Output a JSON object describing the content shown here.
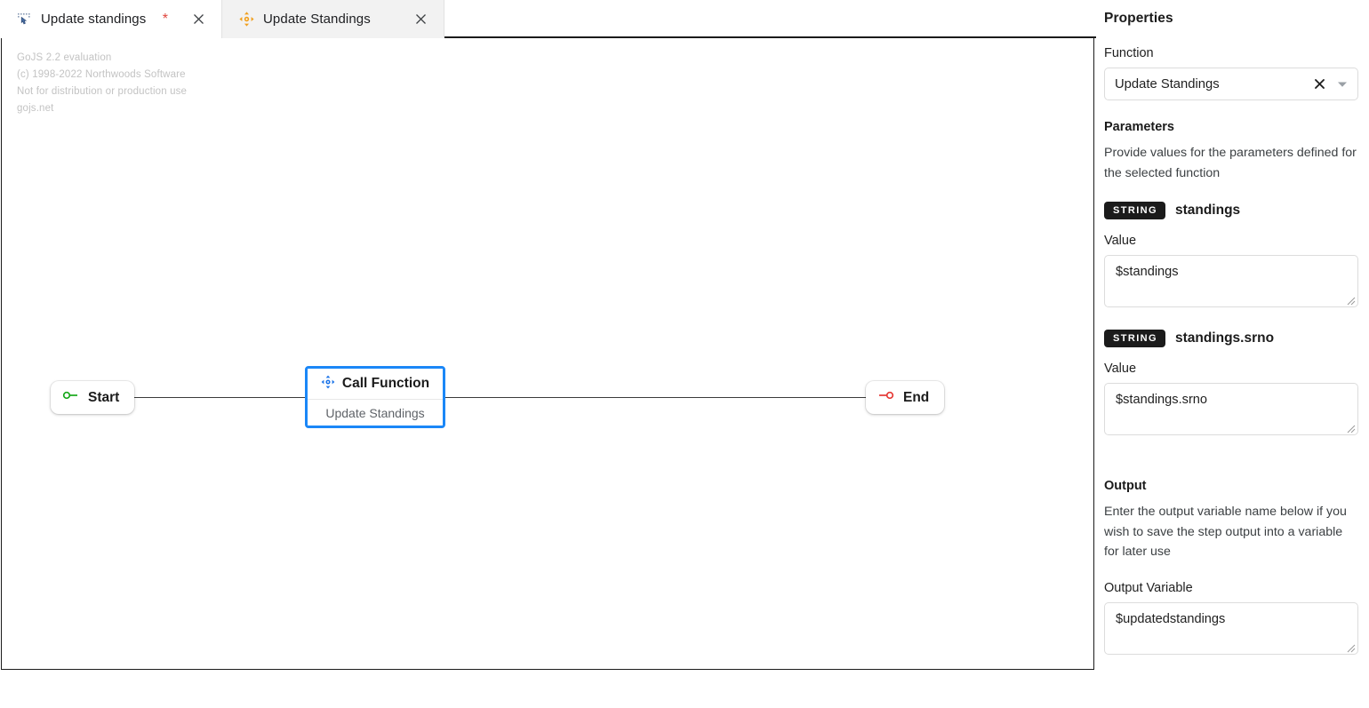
{
  "tabs": [
    {
      "label": "Update standings",
      "dirty_marker": "*",
      "icon": "flow-pointer-icon",
      "close_icon": "close-icon",
      "active": true
    },
    {
      "label": "Update Standings",
      "dirty_marker": "",
      "icon": "move-arrows-icon",
      "close_icon": "close-icon",
      "active": false
    }
  ],
  "canvas": {
    "watermark": "GoJS 2.2 evaluation\n(c) 1998-2022 Northwoods Software\nNot for distribution or production use\ngojs.net",
    "nodes": {
      "start": {
        "label": "Start",
        "icon": "start-port-icon",
        "icon_color": "#17a81a"
      },
      "end": {
        "label": "End",
        "icon": "end-port-icon",
        "icon_color": "#e53935"
      },
      "call_function": {
        "title": "Call Function",
        "subtitle": "Update Standings",
        "icon": "move-arrows-icon",
        "icon_color": "#1a73e8",
        "selection_color": "#1b87f7"
      }
    }
  },
  "panel": {
    "title": "Properties",
    "function": {
      "label": "Function",
      "selected": "Update Standings",
      "clear_icon": "close-icon",
      "caret_icon": "chevron-down-icon"
    },
    "parameters": {
      "heading": "Parameters",
      "description": "Provide values for the parameters defined for the selected function",
      "items": [
        {
          "type_badge": "STRING",
          "name": "standings",
          "value_label": "Value",
          "value": "$standings"
        },
        {
          "type_badge": "STRING",
          "name": "standings.srno",
          "value_label": "Value",
          "value": "$standings.srno"
        }
      ]
    },
    "output": {
      "heading": "Output",
      "description": "Enter the output variable name below if you wish to save the step output into a variable for later use",
      "variable_label": "Output Variable",
      "variable_value": "$updatedstandings"
    }
  }
}
